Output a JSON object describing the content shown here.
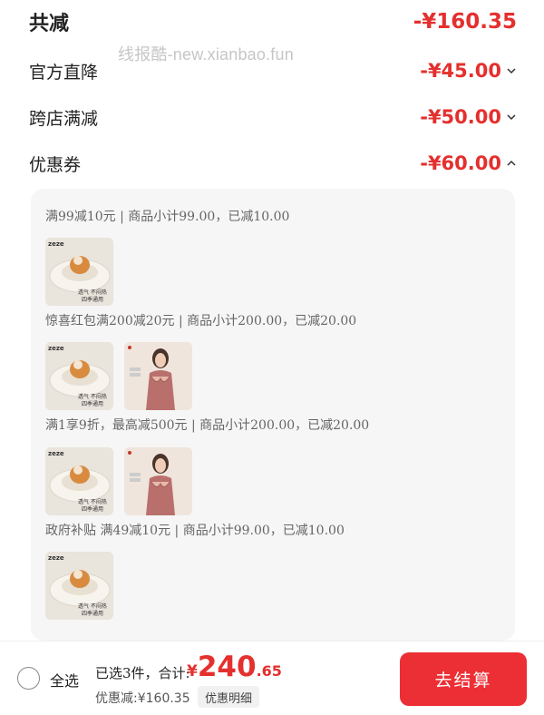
{
  "summary": {
    "total_label": "共减",
    "total_amount": "-¥160.35",
    "rows": [
      {
        "label": "官方直降",
        "amount": "-¥45.00",
        "expanded": false
      },
      {
        "label": "跨店满减",
        "amount": "-¥50.00",
        "expanded": false
      },
      {
        "label": "优惠券",
        "amount": "-¥60.00",
        "expanded": true
      }
    ]
  },
  "watermark": "线报酷-new.xianbao.fun",
  "coupons": [
    {
      "text": "满99减10元 | 商品小计99.00，已减10.00",
      "items": [
        "pet-bed-icon"
      ]
    },
    {
      "text": "惊喜红包满200减20元 | 商品小计200.00，已减20.00",
      "items": [
        "pet-bed-icon",
        "lingerie-icon"
      ]
    },
    {
      "text": "满1享9折，最高减500元 | 商品小计200.00，已减20.00",
      "items": [
        "pet-bed-icon",
        "lingerie-icon"
      ]
    },
    {
      "text": "政府补贴 满49减10元 | 商品小计99.00，已减10.00",
      "items": [
        "pet-bed-icon"
      ]
    }
  ],
  "product_text": {
    "brand": "zeze",
    "bed_caption_1": "透气 不闷热",
    "bed_caption_2": "四季通用"
  },
  "bottom": {
    "select_all": "全选",
    "selected": "已选3件，合计:",
    "currency": "¥",
    "price_int": "240",
    "price_dec": ".65",
    "discount": "优惠减:¥160.35",
    "detail_btn": "优惠明细",
    "checkout": "去结算"
  },
  "colors": {
    "accent": "#e4302e",
    "checkout_bg": "#ec2f35"
  }
}
